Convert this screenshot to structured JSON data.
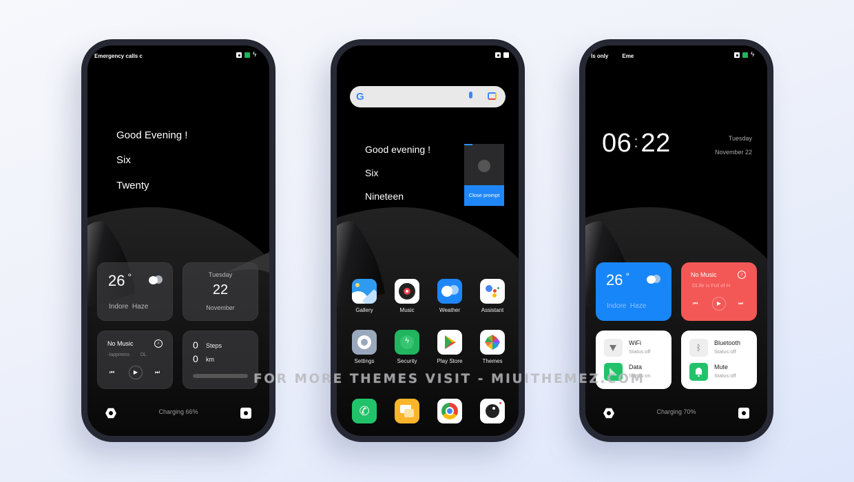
{
  "background": {
    "top_color": "#f7f8fc",
    "bottom_color": "#dde6fb"
  },
  "watermark": "FOR MORE THEMES VISIT - MIUITHEMEZ.COM",
  "phone1": {
    "status_left": "Emergency calls c",
    "status_icons": [
      "record-icon",
      "battery-icon",
      "charging-bolt-icon"
    ],
    "greeting": [
      "Good Evening !",
      "Six",
      "Twenty"
    ],
    "weather": {
      "temp": "26",
      "degree": "°",
      "location": "Indore",
      "condition": "Haze",
      "icon": "cloud-icon"
    },
    "date": {
      "day": "Tuesday",
      "date": "22",
      "month": "November"
    },
    "music": {
      "title": "No Music",
      "subtitle": "-Iappiness",
      "subtitle2": "DL",
      "prev": "⏮",
      "play": "▶",
      "next": "⏭"
    },
    "fitness": {
      "steps_value": "0",
      "steps_label": "Steps",
      "km_value": "0",
      "km_label": "km",
      "progress": 0
    },
    "charging": "Charging 66%",
    "bottom_left_icon": "hexagon-icon",
    "bottom_right_icon": "camera-icon"
  },
  "phone2": {
    "status_icons": [
      "record-icon",
      "battery-icon"
    ],
    "search": {
      "logo": "G",
      "mic": "mic-icon",
      "lens": "lens-icon"
    },
    "greeting": [
      "Good evening !",
      "Six",
      "Nineteen"
    ],
    "prompt": {
      "button": "Close prompt"
    },
    "apps_row1": [
      {
        "label": "Gallery",
        "icon": "gallery-icon",
        "color": "#2f9bf0"
      },
      {
        "label": "Music",
        "icon": "music-icon",
        "color": "#ffffff"
      },
      {
        "label": "Weather",
        "icon": "weather-icon",
        "color": "#1f86f7"
      },
      {
        "label": "Assistant",
        "icon": "assistant-icon",
        "color": "#ffffff"
      }
    ],
    "apps_row2": [
      {
        "label": "Settings",
        "icon": "settings-icon",
        "color": "#9aa8bd"
      },
      {
        "label": "Security",
        "icon": "security-icon",
        "color": "#21b560"
      },
      {
        "label": "Play Store",
        "icon": "play-store-icon",
        "color": "#ffffff"
      },
      {
        "label": "Themes",
        "icon": "themes-icon",
        "color": "#ffffff"
      }
    ],
    "dock": [
      {
        "icon": "phone-icon",
        "color": "#22c26a"
      },
      {
        "icon": "notes-icon",
        "color": "#fbb52b"
      },
      {
        "icon": "chrome-icon",
        "color": "#ffffff"
      },
      {
        "icon": "camera-icon",
        "color": "#ffffff"
      }
    ]
  },
  "phone3": {
    "status_left": "ls only",
    "status_left2": "Eme",
    "status_icons": [
      "record-icon",
      "battery-icon",
      "charging-bolt-icon"
    ],
    "clock": {
      "hours": "06",
      "separator": ":",
      "minutes": "22"
    },
    "date": {
      "day": "Tuesday",
      "month_day": "November  22"
    },
    "weather": {
      "temp": "26",
      "degree": "°",
      "location": "Indore",
      "condition": "Haze",
      "bg": "#1786f8"
    },
    "music": {
      "title": "No Music",
      "subtitle": "DLife is Full of H",
      "bg": "#f35856",
      "prev": "⏮",
      "play": "▶",
      "next": "⏭"
    },
    "toggles": [
      {
        "name": "WiFi",
        "status": "Status:off",
        "icon": "wifi-icon",
        "on": false
      },
      {
        "name": "Data",
        "status": "Status:on",
        "icon": "data-icon",
        "on": true
      },
      {
        "name": "Bluetooth",
        "status": "Status:off",
        "icon": "bluetooth-icon",
        "on": false
      },
      {
        "name": "Mute",
        "status": "Status:off",
        "icon": "bell-icon",
        "on": true
      }
    ],
    "charging": "Charging 70%"
  }
}
